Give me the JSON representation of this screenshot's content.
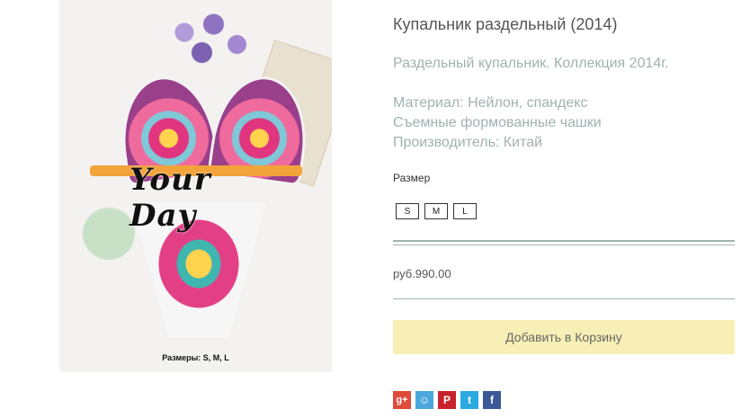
{
  "product": {
    "title": "Купальник раздельный (2014)",
    "short_description": "Раздельный купальник. Коллекция 2014г.",
    "specs": [
      "Материал: Нейлон, спандекс",
      "Съемные формованные чашки",
      "Производитель: Китай"
    ],
    "size_label": "Размер",
    "sizes": [
      "S",
      "M",
      "L"
    ],
    "price": "руб.990.00",
    "add_to_cart_label": "Добавить в Корзину"
  },
  "image": {
    "logo_text": "Your Day",
    "caption": "Размеры: S, M, L"
  },
  "share": {
    "icons": [
      "google-plus-icon",
      "odnoklassniki-icon",
      "pinterest-icon",
      "twitter-icon",
      "facebook-icon"
    ],
    "glyphs": [
      "g+",
      "☺",
      "P",
      "t",
      "f"
    ]
  },
  "colors": {
    "accent_line": "#9fb3b0",
    "cart_button_bg": "#f7efb5",
    "description_text": "#9fb3b0"
  }
}
